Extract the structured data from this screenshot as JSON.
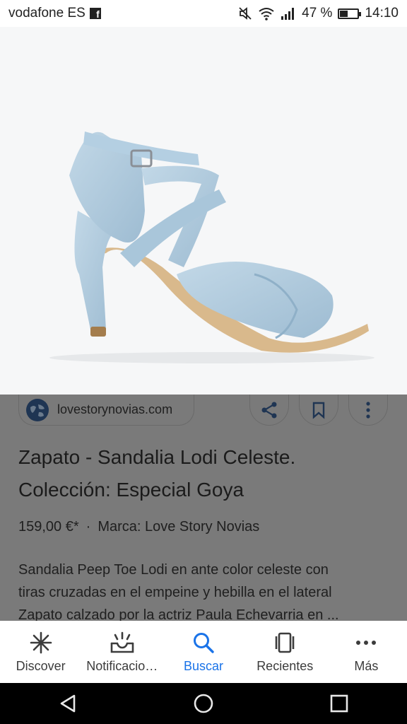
{
  "status_bar": {
    "carrier": "vodafone ES",
    "fb": "f",
    "battery_percent": "47 %",
    "battery_level": 0.47,
    "time": "14:10"
  },
  "result": {
    "source": "lovestorynovias.com",
    "title_line1": "Zapato - Sandalia Lodi Celeste.",
    "title_line2": "Colección: Especial Goya",
    "price": "159,00 €*",
    "separator": "·",
    "brand": "Marca: Love Story Novias",
    "description": [
      "Sandalia Peep Toe Lodi en ante color celeste con",
      "tiras cruzadas en el empeine y hebilla en el lateral",
      "Zapato calzado por la actriz Paula Echevarria en ..."
    ]
  },
  "bottom_nav": {
    "discover": "Discover",
    "notifications": "Notificacio…",
    "search": "Buscar",
    "recent": "Recientes",
    "more": "Más"
  },
  "colors": {
    "accent": "#1a73e8",
    "card_dim": "#7a7a7a",
    "shoe": "#aec9dc"
  }
}
